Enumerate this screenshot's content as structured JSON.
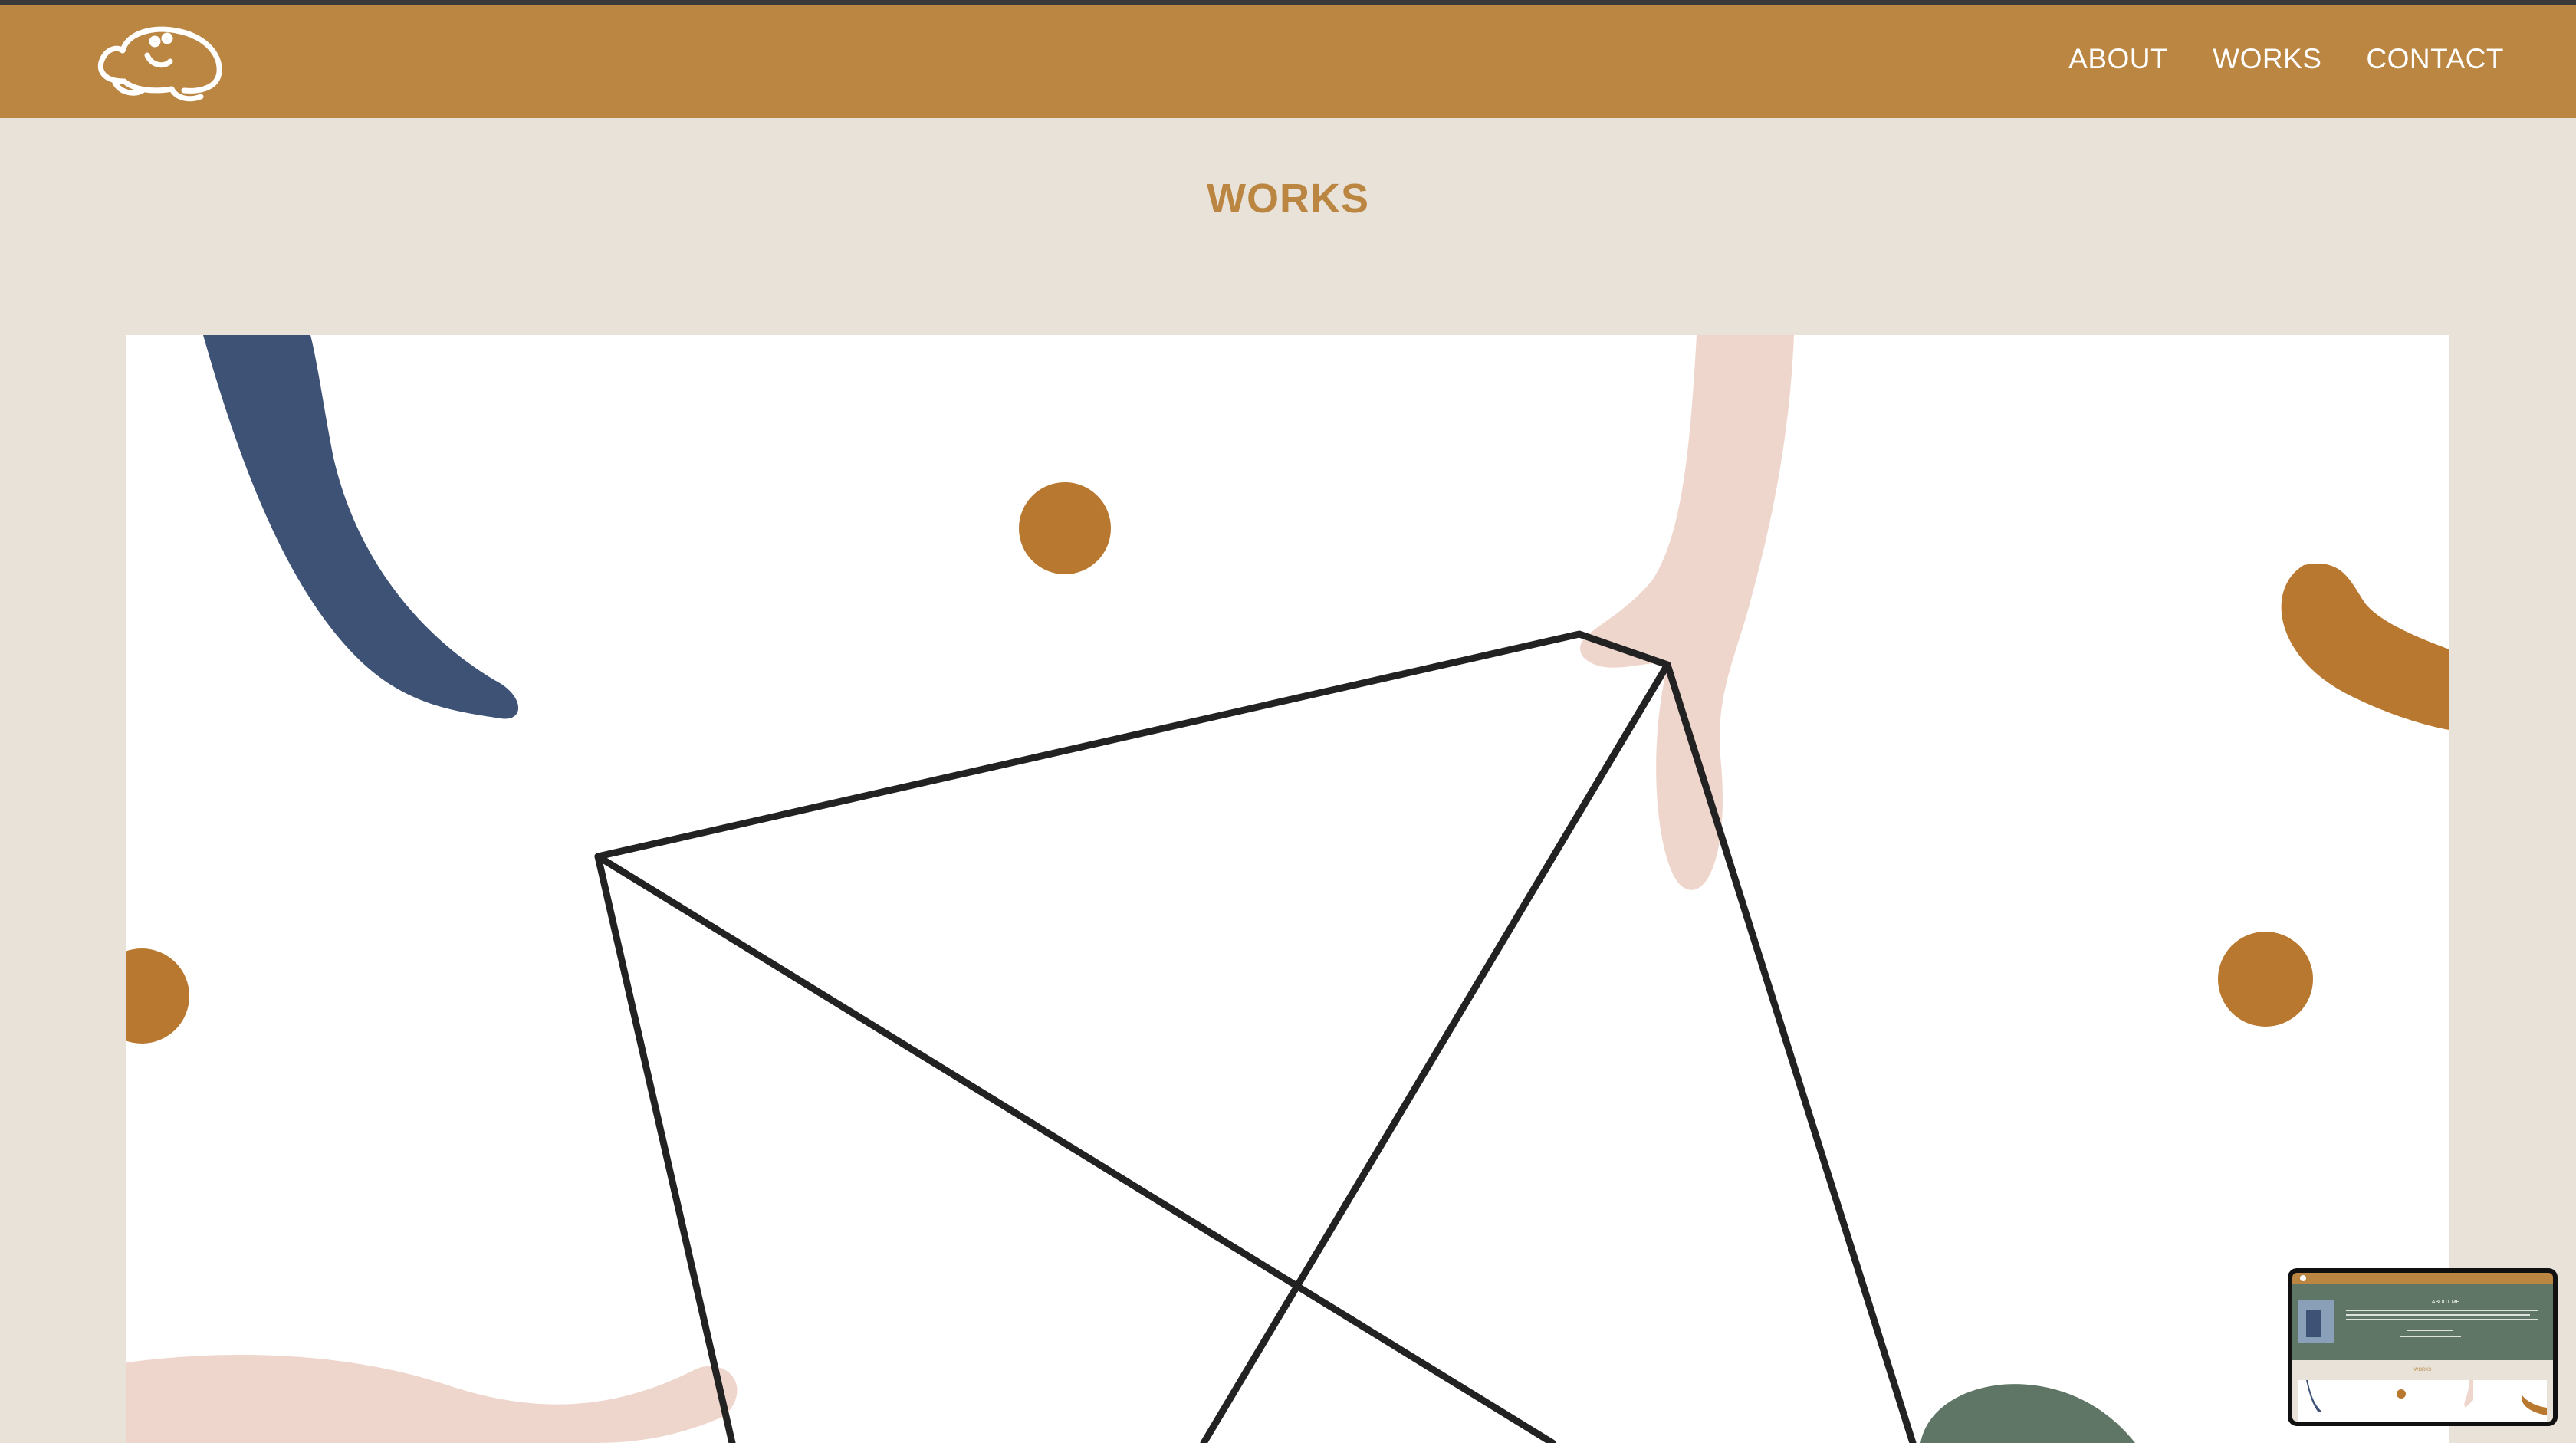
{
  "nav": {
    "items": [
      {
        "label": "ABOUT"
      },
      {
        "label": "WORKS"
      },
      {
        "label": "CONTACT"
      }
    ]
  },
  "page": {
    "title": "WORKS"
  },
  "logo": {
    "icon": "frog-logo-icon"
  },
  "colors": {
    "header": "#bb8642",
    "background": "#e8e2d8",
    "title": "#bb8642",
    "navy": "#3d5275",
    "mustard": "#b9782f",
    "blush": "#efd6cc",
    "sage": "#5f7565"
  },
  "thumbnail": {
    "title": "ABOUT ME",
    "subtitle": "WORKS"
  }
}
